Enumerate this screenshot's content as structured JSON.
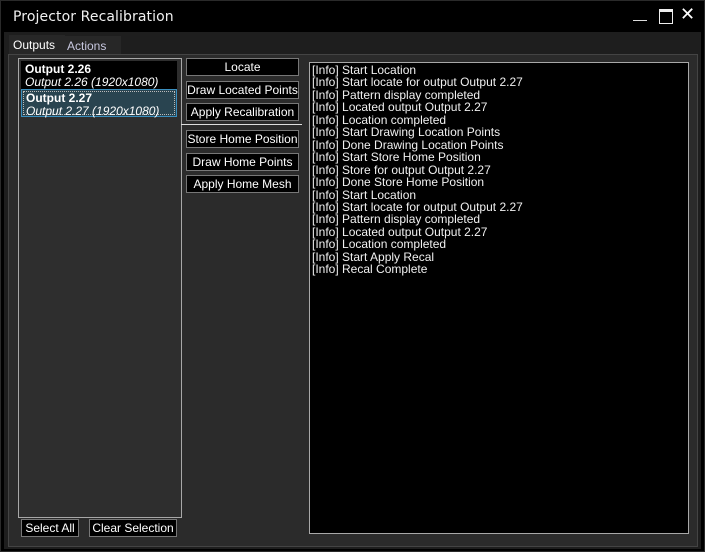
{
  "window": {
    "title": "Projector Recalibration",
    "controls": {
      "minimize_icon": "minimize-icon",
      "maximize_icon": "maximize-icon",
      "close_icon": "close-icon",
      "close_glyph": "✕"
    }
  },
  "tabs": [
    {
      "label": "Outputs",
      "selected": true
    },
    {
      "label": "Actions",
      "selected": false
    }
  ],
  "outputs_list": [
    {
      "name": "Output 2.26",
      "detail": "Output 2.26 (1920x1080)",
      "selected": false
    },
    {
      "name": "Output 2.27",
      "detail": "Output 2.27 (1920x1080)",
      "selected": true
    }
  ],
  "actions": {
    "group1": [
      "Locate",
      "Draw Located Points",
      "Apply Recalibration"
    ],
    "group2": [
      "Store Home Position",
      "Draw Home Points",
      "Apply Home Mesh"
    ]
  },
  "log": [
    "[Info] Start Location",
    "[Info] Start locate for output Output 2.27",
    "[Info] Pattern display completed",
    "[Info] Located output Output 2.27",
    "[Info] Location completed",
    "[Info] Start Drawing Location Points",
    "[Info] Done Drawing Location Points",
    "[Info] Start Store Home Position",
    "[Info] Store for output Output 2.27",
    "[Info] Done Store Home Position",
    "[Info] Start Location",
    "[Info] Start locate for output Output 2.27",
    "[Info] Pattern display completed",
    "[Info] Located output Output 2.27",
    "[Info] Location completed",
    "[Info] Start Apply Recal",
    "[Info] Recal Complete"
  ],
  "footer": {
    "select_all": "Select All",
    "clear_selection": "Clear Selection"
  }
}
